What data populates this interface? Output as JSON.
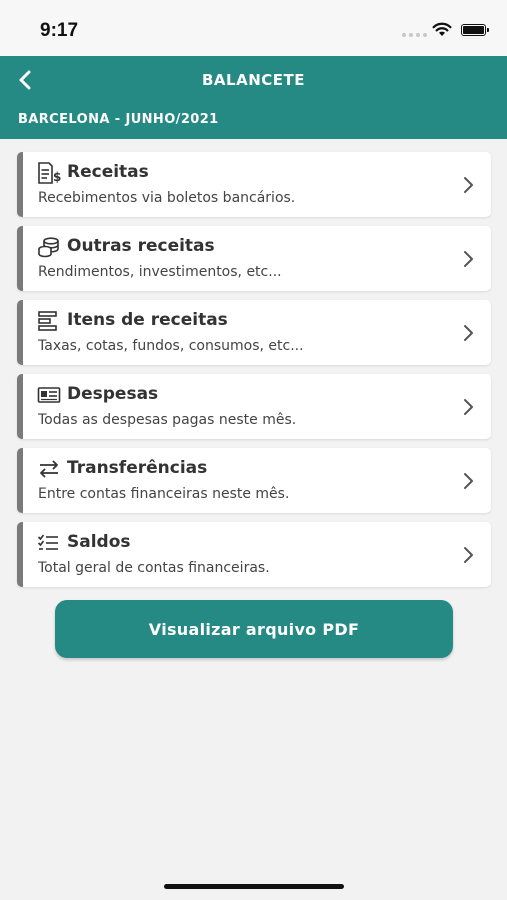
{
  "status_bar": {
    "time": "9:17"
  },
  "nav": {
    "back_icon": "chevron-left-icon",
    "title": "BALANCETE",
    "subtitle": "BARCELONA - JUNHO/2021",
    "background_color": "#268a84"
  },
  "menu": {
    "items": [
      {
        "icon": "receipt-dollar-icon",
        "title": "Receitas",
        "description": "Recebimentos via boletos bancários."
      },
      {
        "icon": "coins-stack-icon",
        "title": "Outras receitas",
        "description": "Rendimentos, investimentos, etc..."
      },
      {
        "icon": "stacked-bars-icon",
        "title": "Itens de receitas",
        "description": "Taxas, cotas, fundos, consumos, etc..."
      },
      {
        "icon": "id-card-icon",
        "title": "Despesas",
        "description": "Todas as despesas pagas neste mês."
      },
      {
        "icon": "arrows-exchange-icon",
        "title": "Transferências",
        "description": "Entre contas financeiras neste mês."
      },
      {
        "icon": "checklist-icon",
        "title": "Saldos",
        "description": "Total geral de contas financeiras."
      }
    ],
    "chevron_icon": "chevron-right-icon",
    "border_color": "#7a7a7a"
  },
  "pdf_button": {
    "label": "Visualizar arquivo PDF",
    "color": "#268a84"
  }
}
